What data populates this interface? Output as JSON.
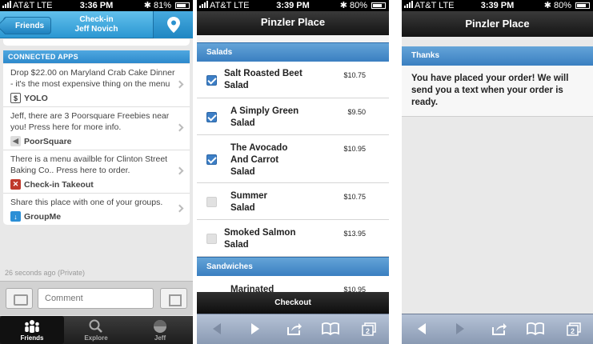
{
  "panel1": {
    "status": {
      "carrier": "AT&T  LTE",
      "time": "3:36 PM",
      "battery": "81%"
    },
    "nav": {
      "back_label": "Friends",
      "title_line1": "Check-in",
      "title_line2": "Jeff Novich",
      "location_icon": "map-pin-icon"
    },
    "section_title": "CONNECTED APPS",
    "apps": [
      {
        "text": "Drop $22.00 on Maryland Crab Cake Dinner - it's the most expensive thing on the menu",
        "app": "YOLO",
        "icon": "dollar-icon",
        "color": "#ffffff"
      },
      {
        "text": "Jeff, there are 3 Poorsquare Freebies near you!  Press here for more info.",
        "app": "PoorSquare",
        "icon": "megaphone-icon",
        "color": "#dddddd"
      },
      {
        "text": "There is a menu availble for Clinton Street Baking Co..  Press here to order.",
        "app": "Check-in Takeout",
        "icon": "takeout-icon",
        "color": "#c0392b"
      },
      {
        "text": "Share this place with one of your groups.",
        "app": "GroupMe",
        "icon": "groupme-icon",
        "color": "#2b8fd6"
      }
    ],
    "timestamp": "26 seconds ago (Private)",
    "comment_placeholder": "Comment",
    "tabs": [
      {
        "label": "Friends",
        "icon": "friends-icon",
        "active": true
      },
      {
        "label": "Explore",
        "icon": "explore-icon",
        "active": false
      },
      {
        "label": "Jeff",
        "icon": "avatar-icon",
        "active": false
      }
    ]
  },
  "panel2": {
    "status": {
      "carrier": "AT&T  LTE",
      "time": "3:39 PM",
      "battery": "80%"
    },
    "title": "Pinzler Place",
    "sections": [
      {
        "name": "Salads",
        "items": [
          {
            "name": "Salt Roasted Beet Salad",
            "price": "$10.75",
            "checked": true
          },
          {
            "name": "A Simply Green Salad",
            "price": "$9.50",
            "checked": true
          },
          {
            "name": "The Avocado And Carrot Salad",
            "price": "$10.95",
            "checked": true
          },
          {
            "name": "Summer Salad",
            "price": "$10.75",
            "checked": false
          },
          {
            "name": "Smoked Salmon Salad",
            "price": "$13.95",
            "checked": false
          }
        ]
      },
      {
        "name": "Sandwiches",
        "items": [
          {
            "name": "Marinated",
            "price": "$10.95",
            "checked": false
          }
        ]
      }
    ],
    "checkout_label": "Checkout"
  },
  "panel3": {
    "status": {
      "carrier": "AT&T  LTE",
      "time": "3:39 PM",
      "battery": "80%"
    },
    "title": "Pinzler Place",
    "section_title": "Thanks",
    "message": "You have placed your order! We will send you a text when your order is ready."
  },
  "safari_toolbar": {
    "page_count": "2",
    "icons": [
      "back-icon",
      "forward-icon",
      "share-icon",
      "bookmarks-icon",
      "pages-icon"
    ]
  }
}
